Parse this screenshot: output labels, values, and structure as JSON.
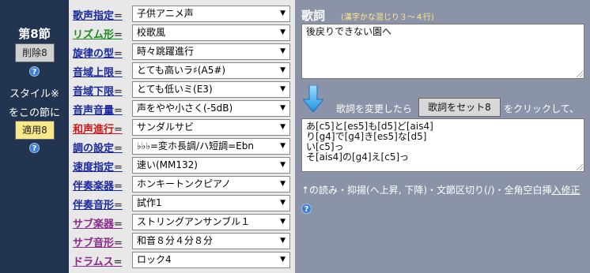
{
  "left": {
    "section_title": "第8節",
    "delete_label": "削除8",
    "style_note_1": "スタイル※",
    "style_note_2": "をこの節に",
    "apply_label": "適用8",
    "help_glyph": "?"
  },
  "settings": [
    {
      "label": "歌声指定",
      "color": "#1a2a9c",
      "value": "子供アニメ声"
    },
    {
      "label": "リズム形",
      "color": "#1d8a1d",
      "value": "校歌風"
    },
    {
      "label": "旋律の型",
      "color": "#1a2a9c",
      "value": "時々跳躍進行"
    },
    {
      "label": "音域上限",
      "color": "#1a2a9c",
      "value": "とても高いラ♯(A5#)"
    },
    {
      "label": "音域下限",
      "color": "#1a2a9c",
      "value": "とても低いミ(E3)"
    },
    {
      "label": "音声音量",
      "color": "#1a2a9c",
      "value": "声をやや小さく(-5dB)"
    },
    {
      "label": "和声進行",
      "color": "#c81a1a",
      "value": "サンダルサビ"
    },
    {
      "label": "調の設定",
      "color": "#1a2a9c",
      "value": "♭♭♭=変ホ長調/ハ短調=Ebn"
    },
    {
      "label": "速度指定",
      "color": "#1a2a9c",
      "value": "速い(MM132)"
    },
    {
      "label": "伴奏楽器",
      "color": "#1a2a9c",
      "value": "ホンキートンクピアノ"
    },
    {
      "label": "伴奏音形",
      "color": "#1a2a9c",
      "value": "試作1"
    },
    {
      "label": "サブ楽器",
      "color": "#8a2a8a",
      "value": "ストリングアンサンブル１"
    },
    {
      "label": "サブ音形",
      "color": "#8a2a8a",
      "value": "和音８分４分８分"
    },
    {
      "label": "ドラムス",
      "color": "#8a2a8a",
      "value": "ロック4"
    }
  ],
  "equals": "=",
  "lyrics": {
    "title": "歌詞",
    "subtitle": "(漢字かな混じり３～４行)",
    "input_value": "後戻りできない園へ",
    "set_prefix": "歌詞を変更したら",
    "set_button": "歌詞をセット8",
    "set_suffix": "をクリックして、",
    "reading_value": "あ[c5]と[es5]も[d5]ど[ais4]\nり[g4]で[g4]き[es5]な[d5]\nい[c5]っ\nそ[ais4]の[g4]え[c5]っ",
    "note_text": "↑の読み・抑揚(ヘ上昇,  下降)・文節区切り(/)・全角空白挿",
    "note_link": "入修正"
  }
}
